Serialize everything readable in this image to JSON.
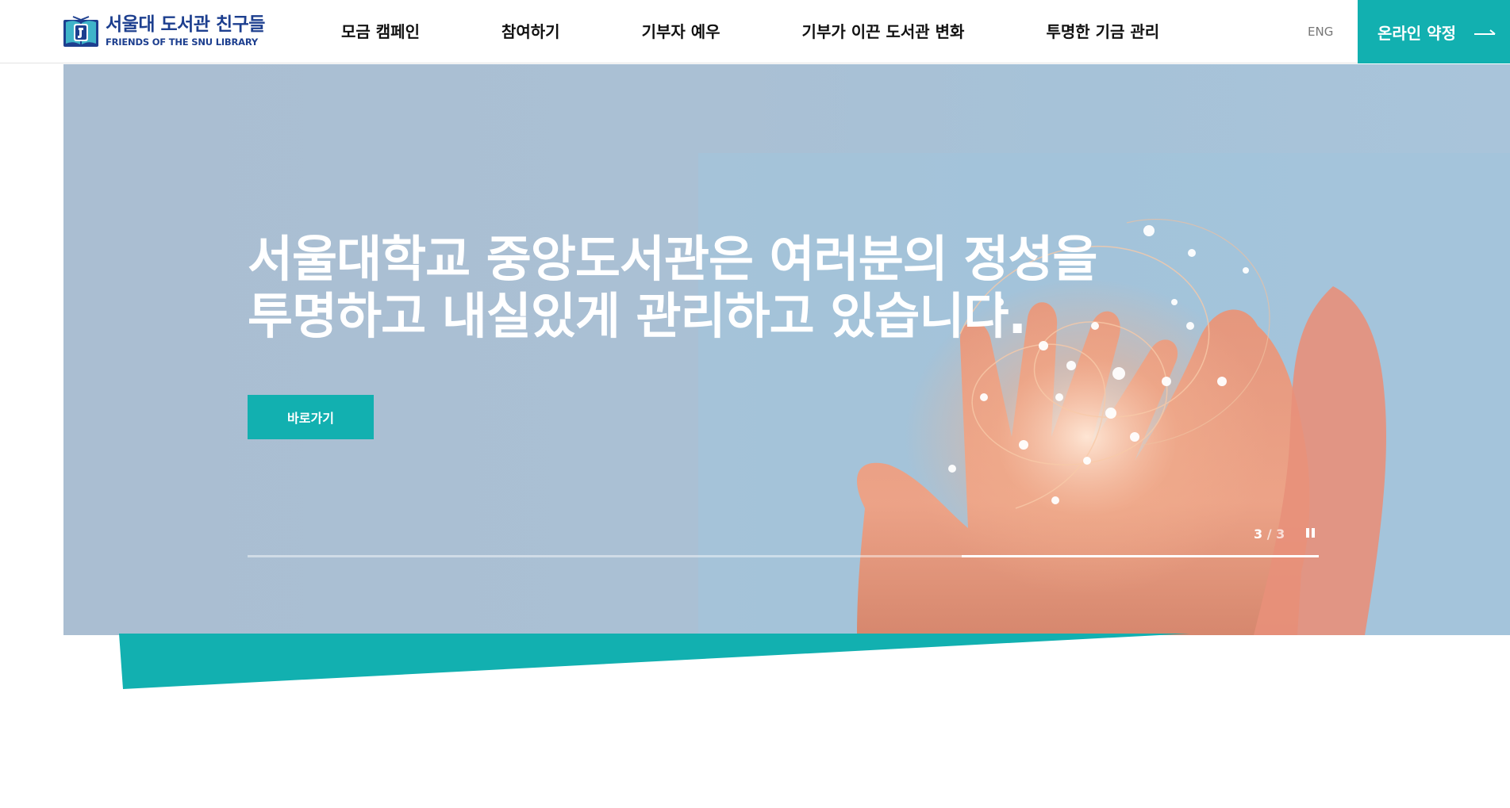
{
  "brand": {
    "name_ko": "서울대 도서관 친구들",
    "name_en": "FRIENDS OF THE SNU LIBRARY",
    "color_primary": "#1d3f8f",
    "color_accent": "#12b0b0"
  },
  "nav": {
    "items": [
      {
        "label": "모금 캠페인"
      },
      {
        "label": "참여하기"
      },
      {
        "label": "기부자 예우"
      },
      {
        "label": "기부가 이끈 도서관 변화"
      },
      {
        "label": "투명한 기금 관리"
      }
    ],
    "lang_label": "ENG",
    "cta_label": "온라인 약정",
    "cta_icon": "arrow-right-icon"
  },
  "hero": {
    "title": "서울대학교 중앙도서관은 여러분의 정성을\n투명하고 내실있게 관리하고 있습니다.",
    "button_label": "바로가기",
    "slide_current": "3",
    "slide_separator": "/",
    "slide_total": "3",
    "pause_icon": "pause-icon",
    "slide_progress": 1.0
  }
}
